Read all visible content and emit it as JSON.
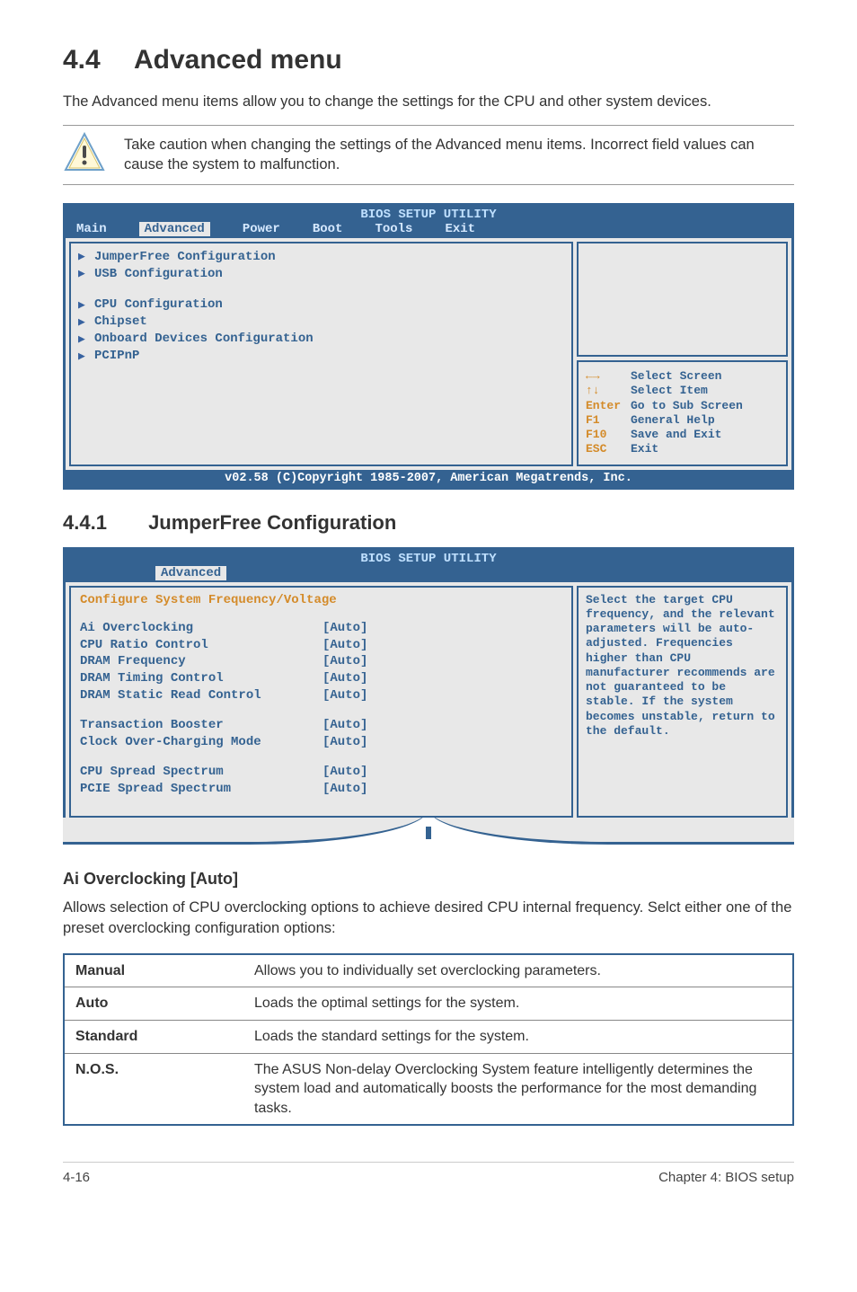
{
  "section": {
    "number": "4.4",
    "title": "Advanced menu",
    "intro": "The Advanced menu items allow you to change the settings for the CPU and other system devices.",
    "caution": "Take caution when changing the settings of the Advanced menu items. Incorrect field values can cause the system to malfunction."
  },
  "bios1": {
    "title": "BIOS SETUP UTILITY",
    "tabs": [
      "Main",
      "Advanced",
      "Power",
      "Boot",
      "Tools",
      "Exit"
    ],
    "active_tab": "Advanced",
    "items_group1": [
      "JumperFree Configuration",
      "USB Configuration"
    ],
    "items_group2": [
      "CPU Configuration",
      "Chipset",
      "Onboard Devices Configuration",
      "PCIPnP"
    ],
    "hints": [
      {
        "key": "←→",
        "text": "Select Screen"
      },
      {
        "key": "↑↓",
        "text": "Select Item"
      },
      {
        "key": "Enter",
        "text": "Go to Sub Screen"
      },
      {
        "key": "F1",
        "text": "General Help"
      },
      {
        "key": "F10",
        "text": "Save and Exit"
      },
      {
        "key": "ESC",
        "text": "Exit"
      }
    ],
    "footer": "v02.58 (C)Copyright 1985-2007, American Megatrends, Inc."
  },
  "subsection": {
    "number": "4.4.1",
    "title": "JumperFree Configuration"
  },
  "bios2": {
    "title": "BIOS SETUP UTILITY",
    "tab": "Advanced",
    "panel_title": "Configure System Frequency/Voltage",
    "rows_a": [
      {
        "k": "Ai Overclocking",
        "v": "[Auto]"
      },
      {
        "k": "CPU Ratio Control",
        "v": "[Auto]"
      },
      {
        "k": "DRAM Frequency",
        "v": "[Auto]"
      },
      {
        "k": "DRAM Timing Control",
        "v": "[Auto]"
      },
      {
        "k": "DRAM Static Read Control",
        "v": "[Auto]"
      }
    ],
    "rows_b": [
      {
        "k": "Transaction Booster",
        "v": "[Auto]"
      },
      {
        "k": "Clock Over-Charging Mode",
        "v": "[Auto]"
      }
    ],
    "rows_c": [
      {
        "k": "CPU  Spread Spectrum",
        "v": "[Auto]"
      },
      {
        "k": "PCIE Spread Spectrum",
        "v": "[Auto]"
      }
    ],
    "help": "Select the target CPU frequency, and the relevant parameters will be auto-adjusted. Frequencies higher than CPU manufacturer recommends are not guaranteed to be stable. If the system becomes unstable, return to the default."
  },
  "ai_over": {
    "heading": "Ai Overclocking [Auto]",
    "desc": "Allows selection of CPU overclocking options to achieve desired CPU internal frequency. Selct either one of the preset overclocking configuration options:"
  },
  "options_table": [
    {
      "key": "Manual",
      "val": "Allows you to individually set overclocking parameters."
    },
    {
      "key": "Auto",
      "val": "Loads the optimal settings for the system."
    },
    {
      "key": "Standard",
      "val": "Loads the standard settings for the system."
    },
    {
      "key": "N.O.S.",
      "val": "The ASUS Non-delay Overclocking System feature intelligently determines the system load and automatically boosts the performance for the most demanding tasks."
    }
  ],
  "footer": {
    "left": "4-16",
    "right": "Chapter 4: BIOS setup"
  }
}
